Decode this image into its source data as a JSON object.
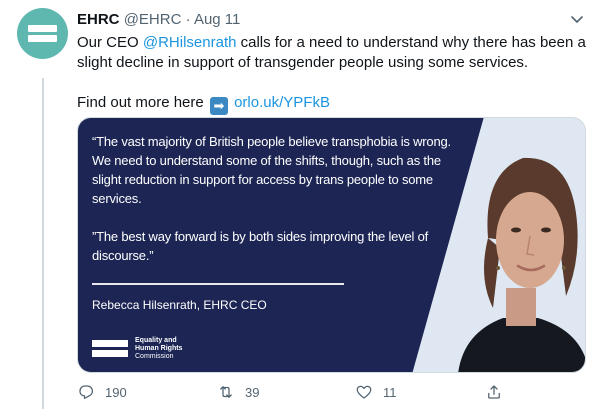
{
  "author": {
    "name": "EHRC",
    "handle": "@EHRC",
    "separator": "·",
    "date": "Aug 11"
  },
  "tweet": {
    "text_before_mention": "Our CEO ",
    "mention": "@RHilsenrath",
    "text_after_mention": " calls for a need to understand why there has been a slight decline in support of transgender people using some services.",
    "find_more_label": "Find out more here",
    "arrow_emoji": "➡",
    "link_text": "orlo.uk/YPFkB"
  },
  "media_card": {
    "quote_paragraph_1": "“The vast majority of British people believe transphobia is wrong. We need to understand some of the shifts, though, such as the slight reduction in support for access by trans people to some services.",
    "quote_paragraph_2": "”The best way forward is by both sides improving the level of discourse.”",
    "attribution": "Rebecca Hilsenrath, EHRC CEO",
    "logo_line_1": "Equality and",
    "logo_line_2": "Human Rights",
    "logo_line_3": "Commission",
    "background_color": "#1c2554"
  },
  "actions": {
    "reply_count": "190",
    "retweet_count": "39",
    "like_count": "11"
  },
  "colors": {
    "link": "#1b95e0",
    "secondary_text": "#536471",
    "avatar": "#5fb8b0"
  },
  "icons": {
    "menu": "chevron-down-icon",
    "reply": "reply-icon",
    "retweet": "retweet-icon",
    "like": "heart-icon",
    "share": "share-icon"
  }
}
